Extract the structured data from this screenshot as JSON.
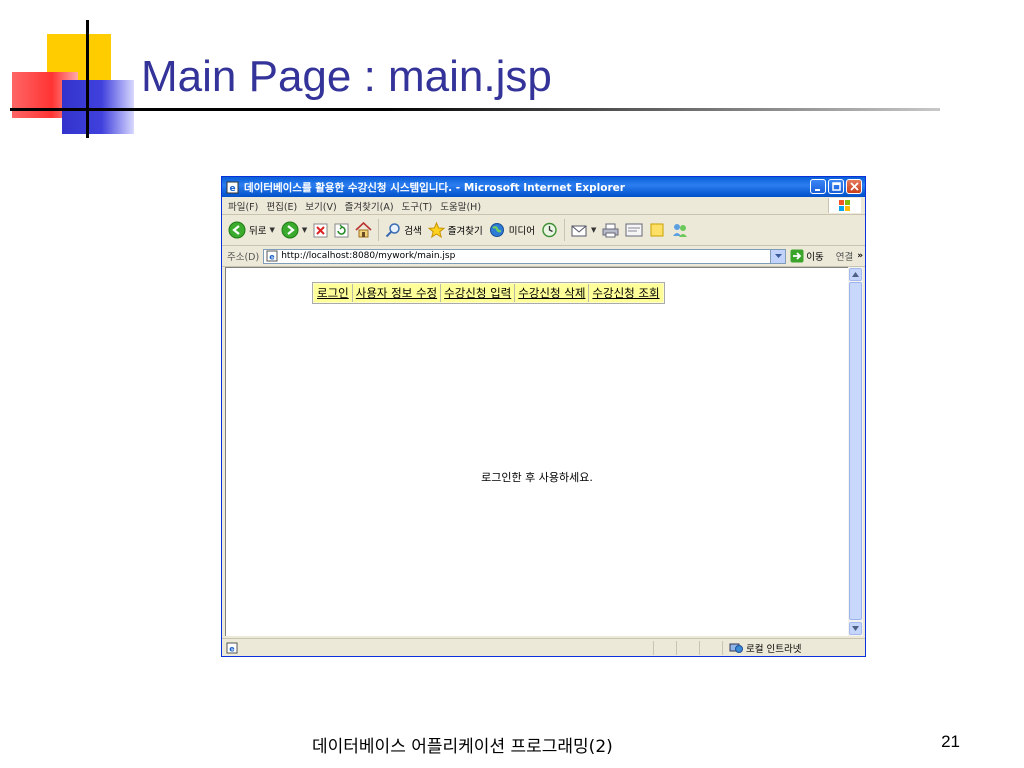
{
  "slide": {
    "title": "Main Page : main.jsp",
    "footer": "데이터베이스 어플리케이션 프로그래밍(2)",
    "page_number": "21"
  },
  "browser": {
    "window_title": "데이터베이스를 활용한 수강신청 시스템입니다. - Microsoft Internet Explorer",
    "menu": [
      "파일(F)",
      "편집(E)",
      "보기(V)",
      "즐겨찾기(A)",
      "도구(T)",
      "도움말(H)"
    ],
    "toolbar": {
      "back": "뒤로",
      "search": "검색",
      "favorites": "즐겨찾기",
      "media": "미디어"
    },
    "address": {
      "label": "주소(D)",
      "url": "http://localhost:8080/mywork/main.jsp",
      "go": "이동",
      "links": "연결"
    },
    "status_zone": "로컬 인트라넷"
  },
  "page": {
    "nav": [
      "로그인",
      "사용자 정보 수정",
      "수강신청 입력",
      "수강신청 삭제",
      "수강신청 조회"
    ],
    "message": "로그인한 후 사용하세요."
  },
  "colors": {
    "title": "#333399",
    "ie_titlebar": "#0a5fd8",
    "nav_bg": "#ffff99"
  }
}
